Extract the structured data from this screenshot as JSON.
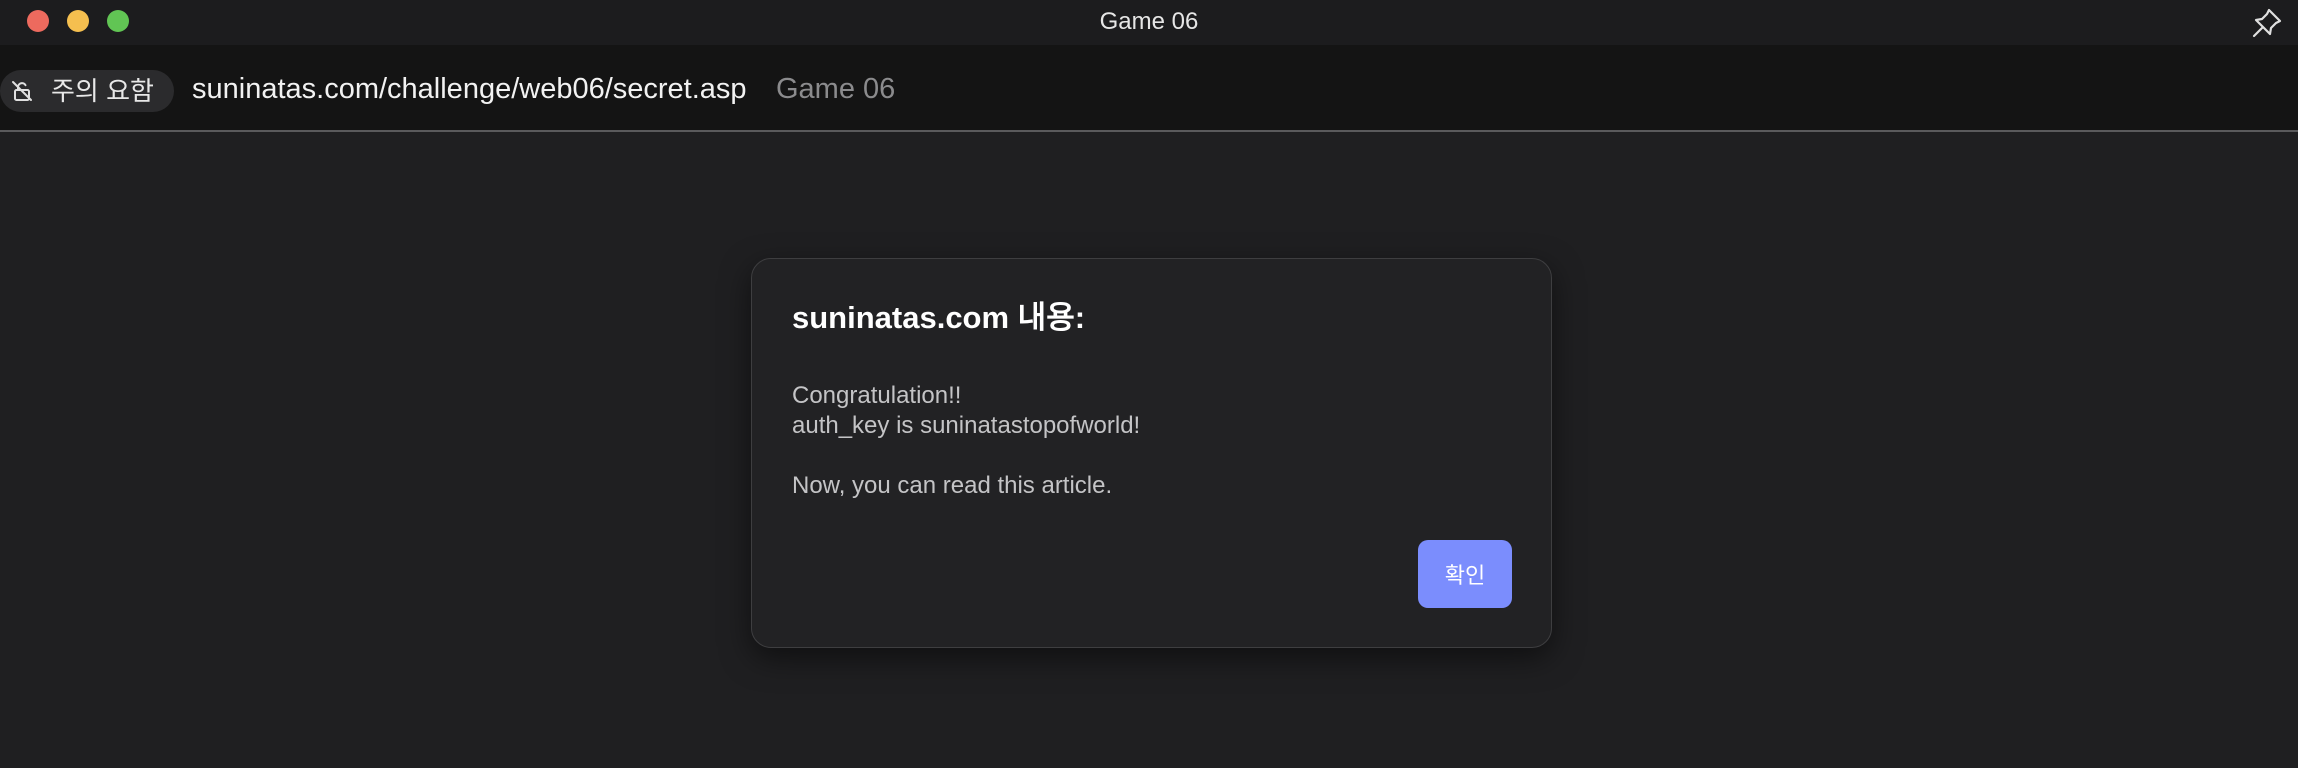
{
  "window": {
    "title": "Game 06"
  },
  "address_bar": {
    "security_label": "주의 요함",
    "url": "suninatas.com/challenge/web06/secret.asp",
    "page_title": "Game 06"
  },
  "dialog": {
    "title": "suninatas.com 내용:",
    "lines": [
      "Congratulation!!",
      "auth_key is suninatastopofworld!",
      "Now, you can read this article."
    ],
    "ok_label": "확인"
  },
  "icons": {
    "pin": "pin-icon",
    "security": "lock-warning-icon"
  },
  "colors": {
    "close": "#ed6a5e",
    "minimize": "#f5bf4f",
    "maximize": "#61c554",
    "accent": "#7b8dfd",
    "background": "#1f1f21"
  }
}
